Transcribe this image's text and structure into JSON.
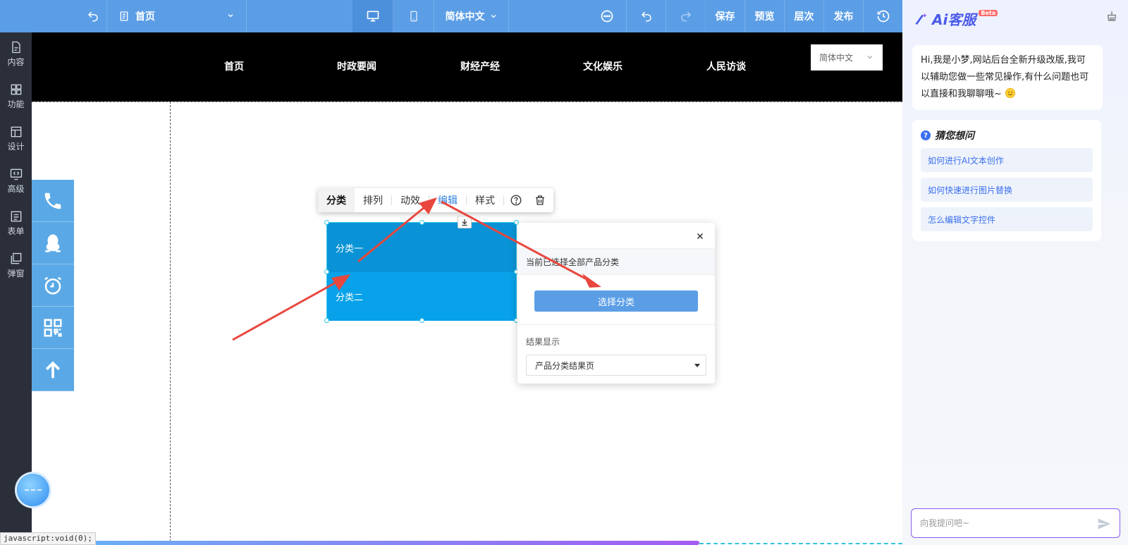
{
  "toolbar": {
    "page_name": "首页",
    "language": "简体中文",
    "save": "保存",
    "preview": "预览",
    "layers": "层次",
    "publish": "发布"
  },
  "sidebar": {
    "items": [
      {
        "label": "内容",
        "icon": "file-icon"
      },
      {
        "label": "功能",
        "icon": "grid-icon"
      },
      {
        "label": "设计",
        "icon": "layout-icon"
      },
      {
        "label": "高级",
        "icon": "code-monitor-icon"
      },
      {
        "label": "表单",
        "icon": "form-icon"
      },
      {
        "label": "弹窗",
        "icon": "popup-icon"
      }
    ]
  },
  "site": {
    "nav": [
      "首页",
      "时政要闻",
      "财经产经",
      "文化娱乐",
      "人民访谈"
    ],
    "language": "简体中文"
  },
  "float_buttons": [
    "phone-icon",
    "qq-icon",
    "alarm-icon",
    "qrcode-icon",
    "arrow-up-icon"
  ],
  "component_toolbar": {
    "items": [
      "分类",
      "排列",
      "动效",
      "编辑",
      "样式"
    ]
  },
  "category_widget": {
    "rows": [
      "分类一",
      "分类二"
    ]
  },
  "popup": {
    "info": "当前已选择全部产品分类",
    "select_button": "选择分类",
    "result_label": "结果显示",
    "result_value": "产品分类结果页"
  },
  "status_text": "javascript:void(0);",
  "ai_panel": {
    "logo_text": "Ai客服",
    "beta": "Beta",
    "greeting": "Hi,我是小梦,网站后台全新升级改版,我可以辅助您做一些常见操作,有什么问题也可以直接和我聊聊哦~",
    "guess_title": "猜您想问",
    "questions": [
      "如何进行AI文本创作",
      "如何快速进行图片替换",
      "怎么编辑文字控件"
    ],
    "input_placeholder": "向我提问吧~"
  },
  "colors": {
    "toolbar": "#5b9ee6",
    "sidebar": "#2b2f3a",
    "accent_blue": "#2b7fe0",
    "category_dark": "#0993d6",
    "category_light": "#08a2ea",
    "arrow_red": "#e8473e"
  }
}
